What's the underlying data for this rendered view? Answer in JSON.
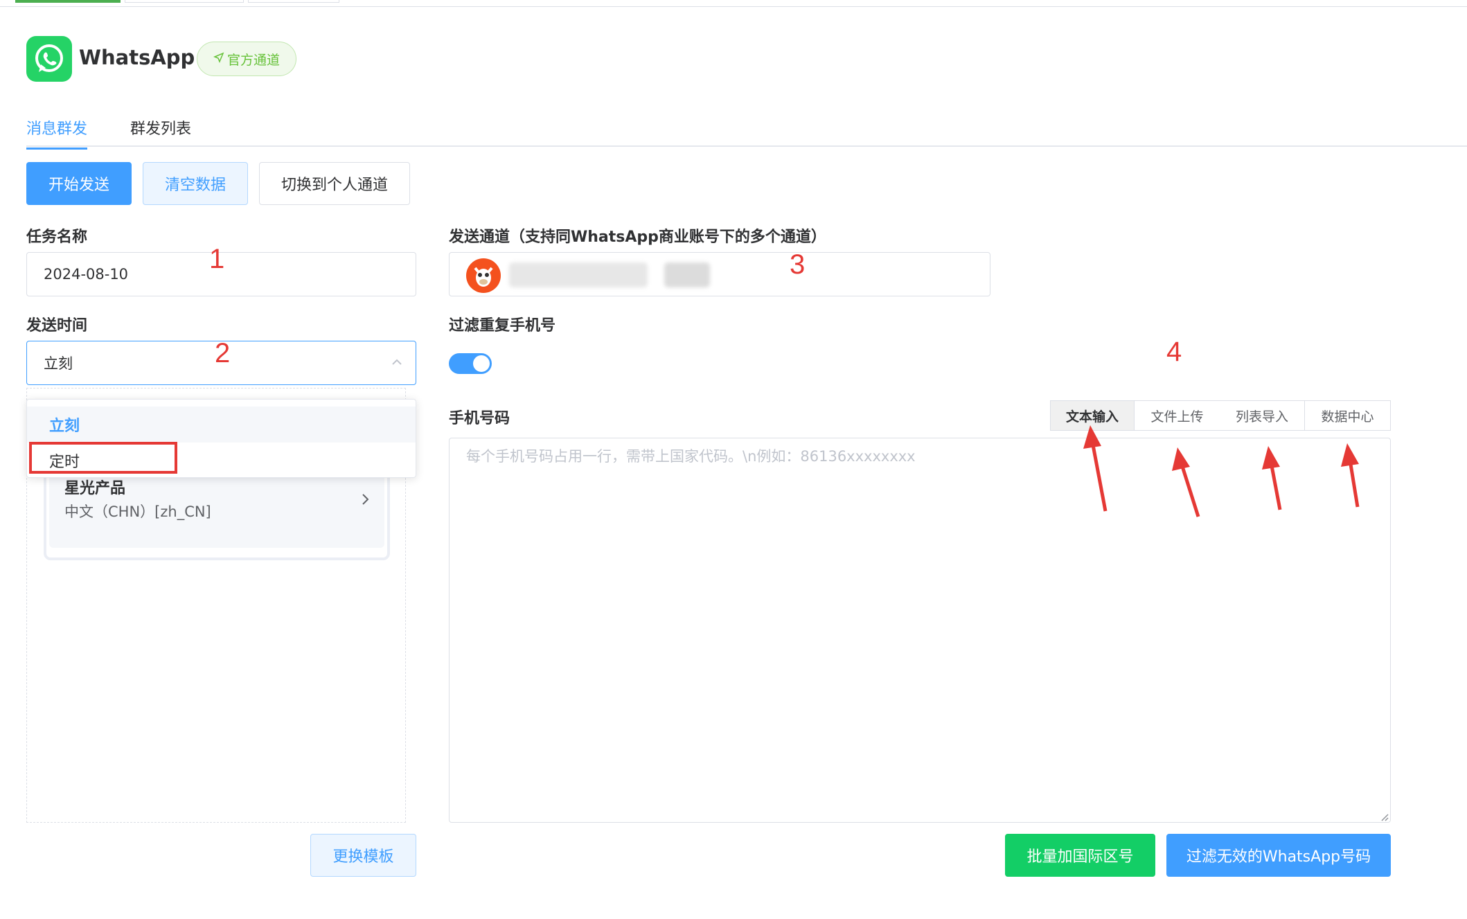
{
  "header": {
    "app_name": "WhatsApp",
    "tag_label": "官方通道",
    "brand_color": "#25d366"
  },
  "tabs": [
    {
      "label": "消息群发",
      "active": true
    },
    {
      "label": "群发列表",
      "active": false
    }
  ],
  "toolbar": {
    "start_label": "开始发送",
    "clear_label": "清空数据",
    "switch_label": "切换到个人通道"
  },
  "form": {
    "task_name_label": "任务名称",
    "task_name_value": "2024-08-10",
    "send_time_label": "发送时间",
    "send_time_value": "立刻",
    "send_time_options": [
      "立刻",
      "定时"
    ],
    "channel_label": "发送通道（支持同WhatsApp商业账号下的多个通道）",
    "filter_dup_label": "过滤重复手机号",
    "filter_dup_on": true,
    "phone_label": "手机号码",
    "phone_placeholder": "每个手机号码占用一行，需带上国家代码。\\n例如：86136xxxxxxxx",
    "input_modes": [
      "文本输入",
      "文件上传",
      "列表导入",
      "数据中心"
    ],
    "active_mode": "文本输入"
  },
  "template": {
    "name": "星光产品",
    "lang": "中文（CHN）[zh_CN]",
    "change_label": "更换模板"
  },
  "actions": {
    "add_code_label": "批量加国际区号",
    "filter_invalid_label": "过滤无效的WhatsApp号码"
  },
  "annotations": [
    "1",
    "2",
    "3",
    "4"
  ]
}
